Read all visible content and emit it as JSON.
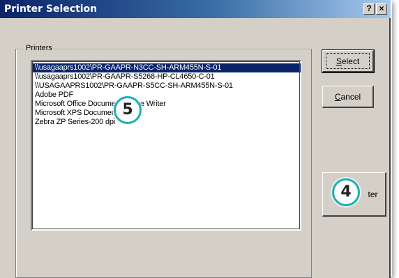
{
  "window": {
    "title": "Printer Selection",
    "help_label": "?",
    "close_label": "×"
  },
  "printers_group": {
    "label": "Printers",
    "items": [
      {
        "label": "\\\\usagaaprs1002\\PR-GAAPR-N3CC-SH-ARM455N-S-01",
        "selected": true
      },
      {
        "label": "\\\\usagaaprs1002\\PR-GAAPR-S5268-HP-CL4650-C-01",
        "selected": false
      },
      {
        "label": "\\\\USAGAAPRS1002\\PR-GAAPR-S5CC-SH-ARM455N-S-01",
        "selected": false
      },
      {
        "label": "Adobe PDF",
        "selected": false
      },
      {
        "label": "Microsoft Office Document Image Writer",
        "selected": false
      },
      {
        "label": "Microsoft XPS Document Writer",
        "selected": false
      },
      {
        "label": "Zebra  ZP Series-200 dpi",
        "selected": false
      }
    ]
  },
  "buttons": {
    "select_label": "Select",
    "cancel_label": "Cancel",
    "other_label": "ter"
  },
  "callouts": {
    "badge_5": "5",
    "badge_4": "4",
    "accent_color": "#1bb0b5"
  }
}
